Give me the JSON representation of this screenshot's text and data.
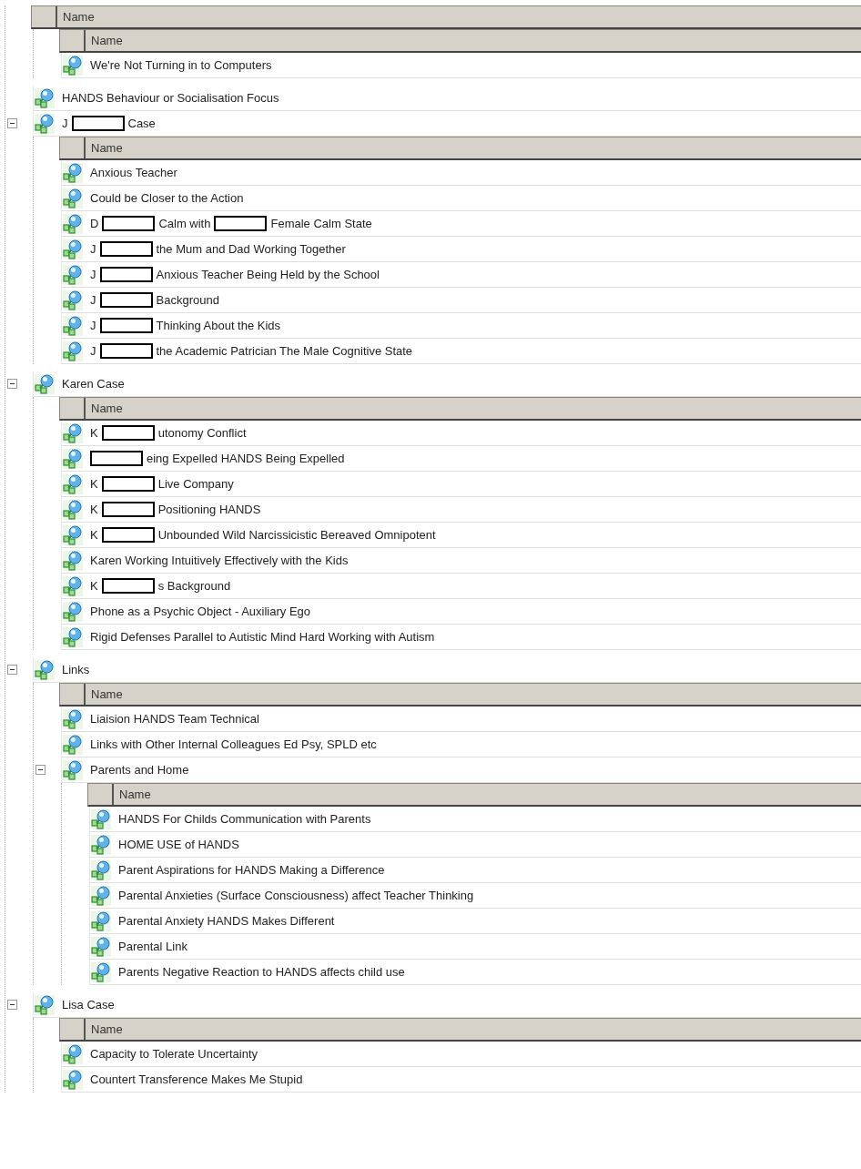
{
  "tree": {
    "header": "Name",
    "items": [
      {
        "header": "Name",
        "children": [
          {
            "label": "We're Not Turning in to Computers"
          }
        ]
      },
      {
        "label": "HANDS Behaviour or Socialisation Focus"
      },
      {
        "parts": [
          {
            "kind": "text",
            "text": "J"
          },
          {
            "kind": "redaction"
          },
          {
            "kind": "text",
            "text": "Case"
          }
        ],
        "expanded": true,
        "header": "Name",
        "children": [
          {
            "label": "Anxious Teacher"
          },
          {
            "label": "Could be Closer to the Action"
          },
          {
            "parts": [
              {
                "kind": "text",
                "text": "D"
              },
              {
                "kind": "redaction"
              },
              {
                "kind": "text",
                "text": "Calm with"
              },
              {
                "kind": "redaction"
              },
              {
                "kind": "text",
                "text": "Female Calm State"
              }
            ]
          },
          {
            "parts": [
              {
                "kind": "text",
                "text": "J"
              },
              {
                "kind": "redaction"
              },
              {
                "kind": "text",
                "text": "the Mum and Dad Working Together"
              }
            ]
          },
          {
            "parts": [
              {
                "kind": "text",
                "text": "J"
              },
              {
                "kind": "redaction"
              },
              {
                "kind": "text",
                "text": "Anxious Teacher Being Held by the School"
              }
            ]
          },
          {
            "parts": [
              {
                "kind": "text",
                "text": "J"
              },
              {
                "kind": "redaction"
              },
              {
                "kind": "text",
                "text": "Background"
              }
            ]
          },
          {
            "parts": [
              {
                "kind": "text",
                "text": "J"
              },
              {
                "kind": "redaction"
              },
              {
                "kind": "text",
                "text": "Thinking About the Kids"
              }
            ]
          },
          {
            "parts": [
              {
                "kind": "text",
                "text": "J"
              },
              {
                "kind": "redaction"
              },
              {
                "kind": "text",
                "text": "the Academic Patrician The Male Cognitive State"
              }
            ]
          }
        ]
      },
      {
        "label": "Karen Case",
        "expanded": true,
        "header": "Name",
        "children": [
          {
            "parts": [
              {
                "kind": "text",
                "text": "K"
              },
              {
                "kind": "redaction"
              },
              {
                "kind": "text",
                "text": "utonomy Conflict"
              }
            ]
          },
          {
            "parts": [
              {
                "kind": "redaction"
              },
              {
                "kind": "text",
                "text": "eing Expelled HANDS Being Expelled"
              }
            ]
          },
          {
            "parts": [
              {
                "kind": "text",
                "text": "K"
              },
              {
                "kind": "redaction"
              },
              {
                "kind": "text",
                "text": "Live Company"
              }
            ]
          },
          {
            "parts": [
              {
                "kind": "text",
                "text": "K"
              },
              {
                "kind": "redaction"
              },
              {
                "kind": "text",
                "text": "Positioning HANDS"
              }
            ]
          },
          {
            "parts": [
              {
                "kind": "text",
                "text": "K"
              },
              {
                "kind": "redaction"
              },
              {
                "kind": "text",
                "text": "Unbounded Wild Narcissicistic Bereaved Omnipotent"
              }
            ]
          },
          {
            "label": "Karen Working Intuitively Effectively with the Kids"
          },
          {
            "parts": [
              {
                "kind": "text",
                "text": "K"
              },
              {
                "kind": "redaction"
              },
              {
                "kind": "text",
                "text": "s Background"
              }
            ]
          },
          {
            "label": "Phone as a Psychic Object - Auxiliary Ego"
          },
          {
            "label": "Rigid Defenses Parallel to Autistic Mind Hard Working with Autism"
          }
        ]
      },
      {
        "label": "Links",
        "expanded": true,
        "header": "Name",
        "children": [
          {
            "label": "Liaision HANDS Team Technical"
          },
          {
            "label": "Links with Other Internal Colleagues Ed Psy, SPLD etc"
          },
          {
            "label": "Parents and Home",
            "expanded": true,
            "header": "Name",
            "children": [
              {
                "label": "HANDS For Childs Communication with Parents"
              },
              {
                "label": "HOME USE of HANDS"
              },
              {
                "label": "Parent Aspirations for HANDS Making a Difference"
              },
              {
                "label": "Parental Anxieties (Surface Consciousness) affect Teacher Thinking"
              },
              {
                "label": "Parental Anxiety HANDS Makes Different"
              },
              {
                "label": "Parental Link"
              },
              {
                "label": "Parents Negative Reaction to HANDS affects child use"
              }
            ]
          }
        ]
      },
      {
        "label": "Lisa Case",
        "expanded": true,
        "header": "Name",
        "children": [
          {
            "label": "Capacity to Tolerate Uncertainty"
          },
          {
            "label": "Countert Transference Makes Me Stupid"
          }
        ]
      }
    ]
  }
}
